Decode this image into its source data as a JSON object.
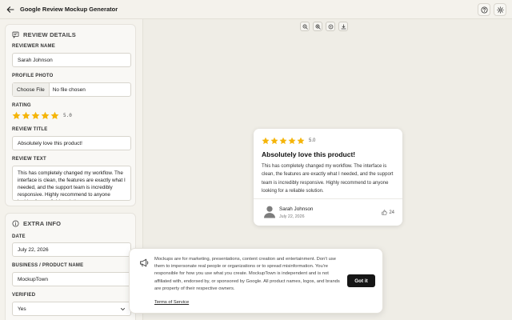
{
  "header": {
    "title": "Google Review Mockup Generator",
    "back_icon": "arrow-left-icon",
    "help_icon": "help-circle-icon",
    "settings_icon": "gear-icon"
  },
  "review_details": {
    "section_title": "REVIEW DETAILS",
    "reviewer_name_label": "REVIEWER NAME",
    "reviewer_name_value": "Sarah Johnson",
    "profile_photo_label": "PROFILE PHOTO",
    "choose_file_label": "Choose File",
    "file_status": "No file chosen",
    "rating_label": "RATING",
    "rating_value": "5.0",
    "rating_stars": 5,
    "review_title_label": "REVIEW TITLE",
    "review_title_value": "Absolutely love this product!",
    "review_text_label": "REVIEW TEXT",
    "review_text_value": "This has completely changed my workflow. The interface is clean, the features are exactly what I needed, and the support team is incredibly responsive. Highly recommend to anyone looking for a reliable solution."
  },
  "extra_info": {
    "section_title": "EXTRA INFO",
    "date_label": "DATE",
    "date_value": "July 22, 2026",
    "business_label": "BUSINESS / PRODUCT NAME",
    "business_value": "MockupTown",
    "verified_label": "VERIFIED",
    "verified_value": "Yes"
  },
  "toolbar": {
    "zoom_out_icon": "zoom-out-icon",
    "zoom_in_icon": "zoom-in-icon",
    "zoom_reset_icon": "zoom-reset-icon",
    "download_icon": "download-icon"
  },
  "preview": {
    "rating": "5.0",
    "title": "Absolutely love this product!",
    "text": "This has completely changed my workflow. The interface is clean, the features are exactly what I needed, and the support team is incredibly responsive. Highly recommend to anyone looking for a reliable solution.",
    "reviewer_name": "Sarah Johnson",
    "date": "July 22, 2026",
    "likes": "24"
  },
  "banner": {
    "text": "Mockups are for marketing, presentations, content creation and entertainment. Don't use them to impersonate real people or organizations or to spread misinformation. You're responsible for how you use what you create. MockupTown is independent and is not affiliated with, endorsed by, or sponsored by Google. All product names, logos, and brands are property of their respective owners.",
    "link_label": "Terms of Service",
    "button_label": "Got it"
  },
  "colors": {
    "star": "#f5b50a",
    "button_dark": "#161616",
    "background": "#f4f2ec"
  }
}
